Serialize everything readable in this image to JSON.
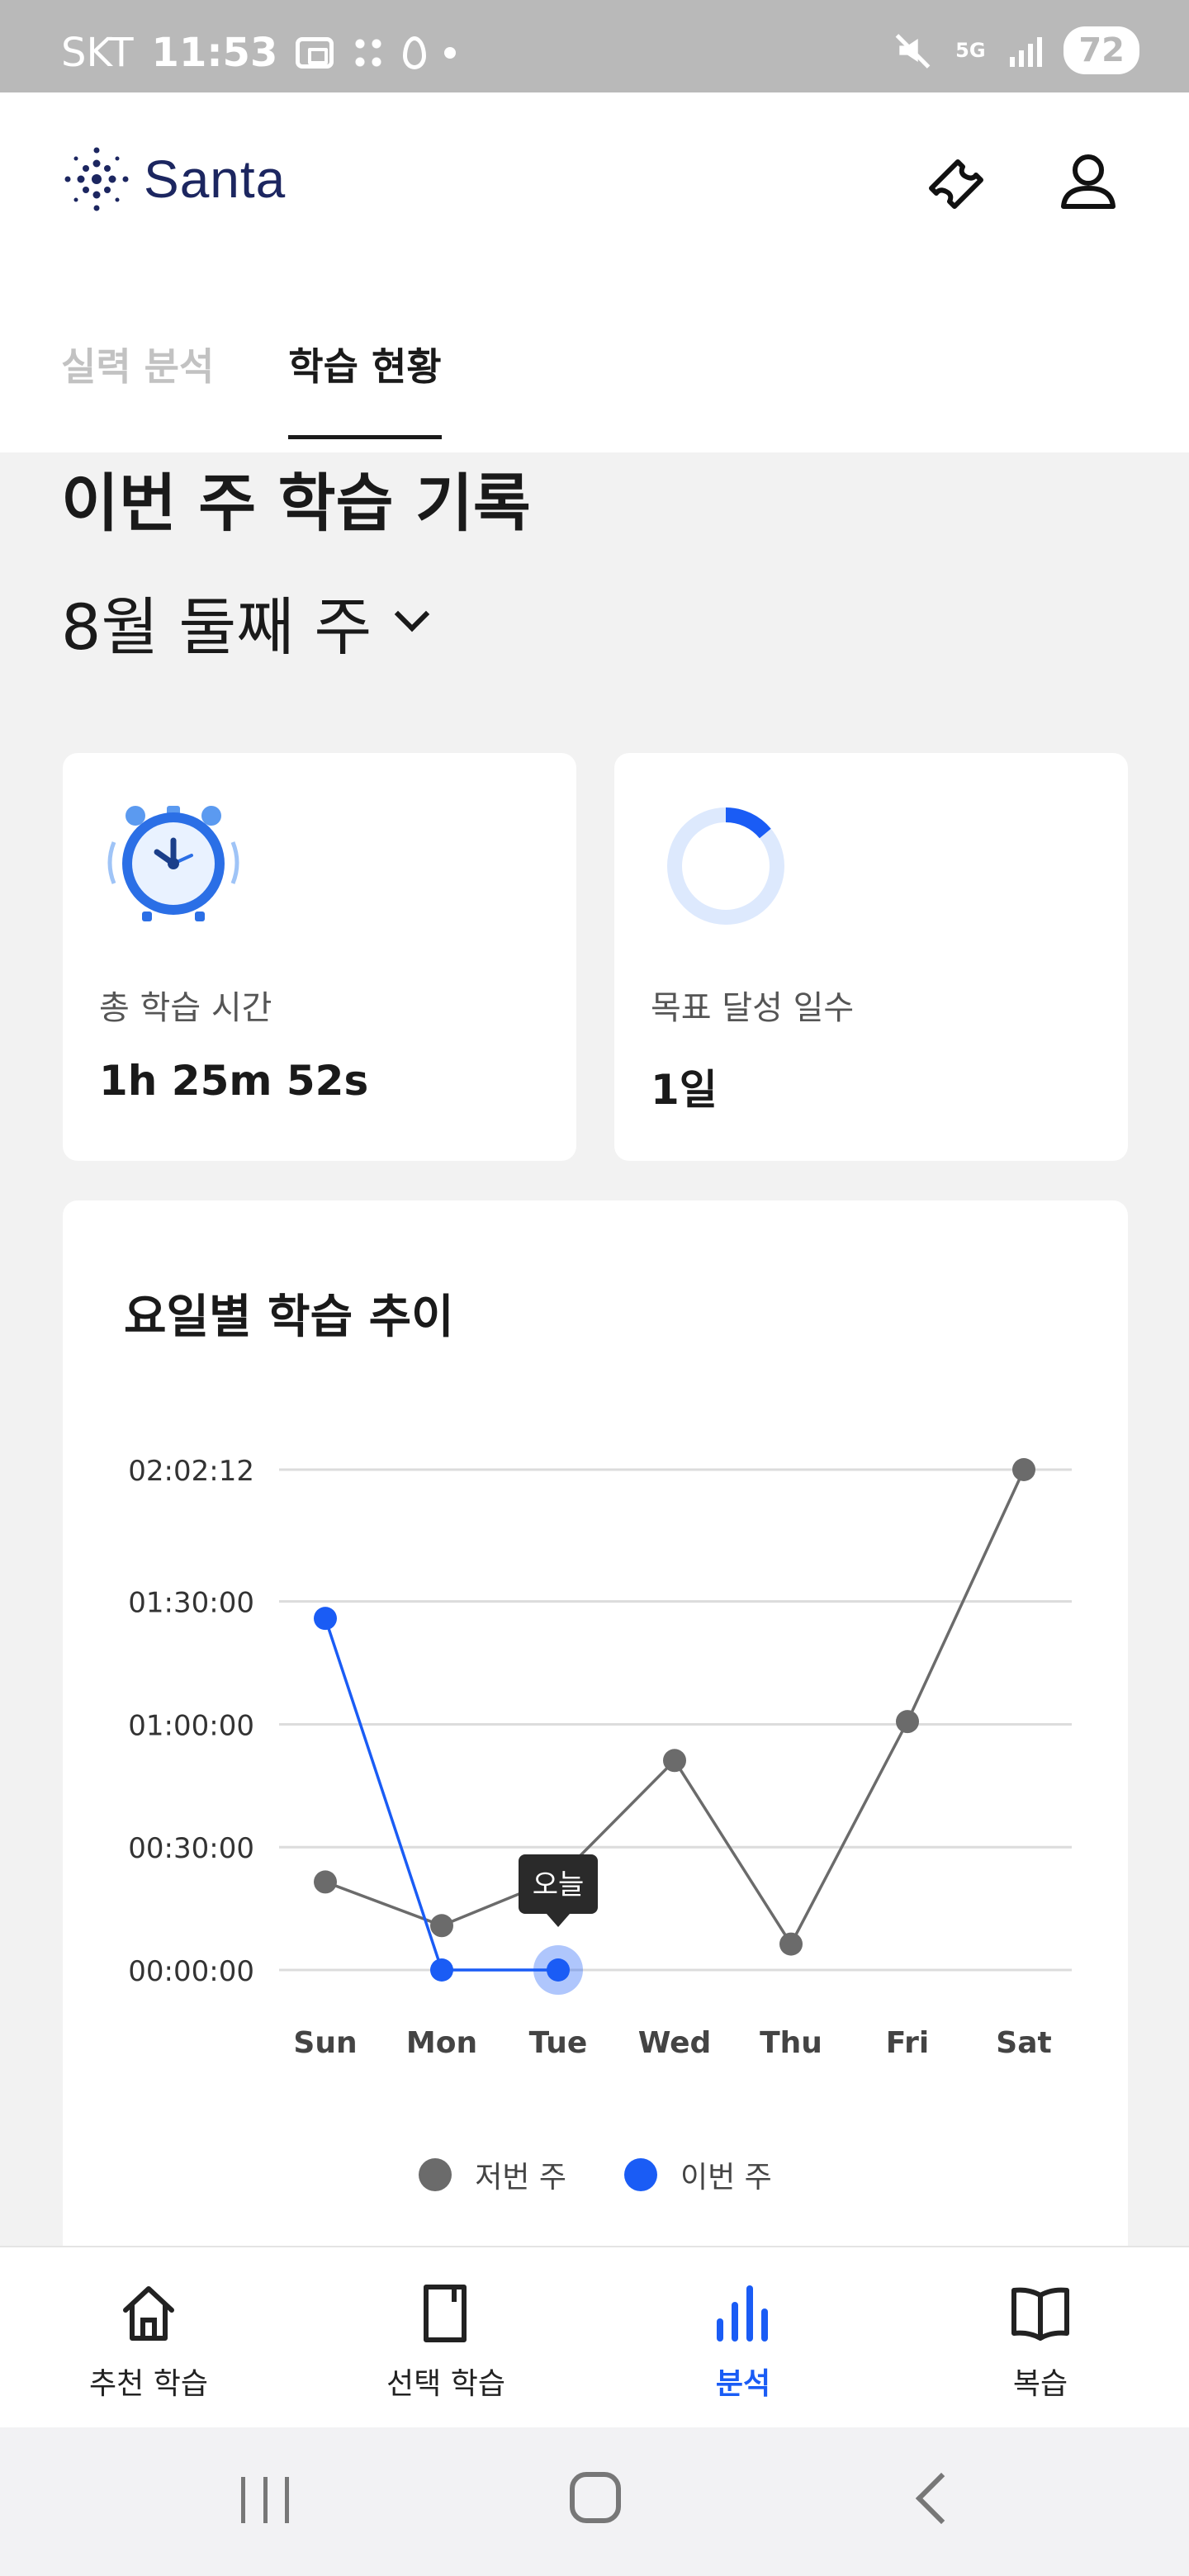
{
  "status_bar": {
    "carrier": "SKT",
    "time": "11:53",
    "network": "5G",
    "battery": "72"
  },
  "header": {
    "logo_text": "Santa",
    "brand_color": "#1c2660",
    "accent_color": "#1a5cf5"
  },
  "tabs": [
    {
      "label": "실력 분석",
      "active": false
    },
    {
      "label": "학습 현황",
      "active": true
    }
  ],
  "section": {
    "title": "이번 주 학습 기록",
    "week_label": "8월 둘째 주"
  },
  "stats": {
    "total_time": {
      "label": "총 학습 시간",
      "value": "1h 25m 52s",
      "icon": "alarm-clock-icon"
    },
    "goal_days": {
      "label": "목표 달성 일수",
      "value": "1일",
      "progress": 0.14,
      "icon": "progress-ring-icon"
    }
  },
  "chart_card": {
    "title": "요일별 학습 추이",
    "tooltip": "오늘"
  },
  "chart_data": {
    "type": "line",
    "title": "요일별 학습 추이",
    "categories": [
      "Sun",
      "Mon",
      "Tue",
      "Wed",
      "Thu",
      "Fri",
      "Sat"
    ],
    "y_tick_labels": [
      "00:00:00",
      "00:30:00",
      "01:00:00",
      "01:30:00",
      "02:02:12"
    ],
    "y_tick_seconds": [
      0,
      1800,
      3600,
      5400,
      7332
    ],
    "ylim": [
      0,
      7332
    ],
    "grid": true,
    "legend_position": "bottom",
    "series": [
      {
        "name": "저번 주",
        "color": "#6b6b6b",
        "values_seconds": [
          1290,
          650,
          1350,
          3070,
          380,
          3640,
          7332
        ]
      },
      {
        "name": "이번 주",
        "color": "#1a5cf5",
        "values_seconds": [
          5152,
          0,
          0,
          null,
          null,
          null,
          null
        ]
      }
    ],
    "highlight": {
      "category": "Tue",
      "series": "이번 주",
      "label": "오늘"
    }
  },
  "bottom_nav": [
    {
      "label": "추천 학습",
      "icon": "home-icon",
      "active": false
    },
    {
      "label": "선택 학습",
      "icon": "book-closed-icon",
      "active": false
    },
    {
      "label": "분석",
      "icon": "bar-chart-icon",
      "active": true
    },
    {
      "label": "복습",
      "icon": "open-book-icon",
      "active": false
    }
  ]
}
